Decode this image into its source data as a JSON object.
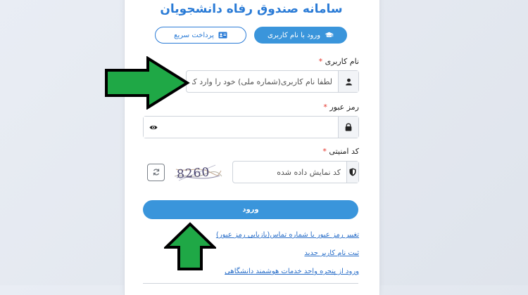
{
  "page": {
    "title": "سامانه صندوق رفاه دانشجویان"
  },
  "tabs": [
    {
      "label": "ورود با نام کاربری",
      "icon": "graduation-cap-icon",
      "active": true
    },
    {
      "label": "پرداخت سریع",
      "icon": "id-card-icon",
      "active": false
    }
  ],
  "form": {
    "username_label": "نام کاربری",
    "username_placeholder": "لطفا نام کاربری(شماره ملی) خود را وارد کنید",
    "username_icon": "user-icon",
    "password_label": "رمز عبور",
    "password_icon": "lock-icon",
    "password_toggle_icon": "eye-icon",
    "captcha_label": "کد امنیتی",
    "captcha_placeholder": "کد نمایش داده شده",
    "captcha_icon": "shield-icon",
    "captcha_text": "8260",
    "refresh_icon": "refresh-icon",
    "required_mark": "*",
    "submit_label": "ورود"
  },
  "links": [
    "تغییر رمز عبور با شماره تماس(بازیابی رمز عبور)",
    "ثبت نام کاربر جدید",
    "ورود از پنجره واحد خدمات هوشمند دانشگاهی"
  ],
  "colors": {
    "primary": "#3a95db",
    "title": "#2a7bd6",
    "required": "#e5342a",
    "annotation_arrow": "#1fa846"
  }
}
